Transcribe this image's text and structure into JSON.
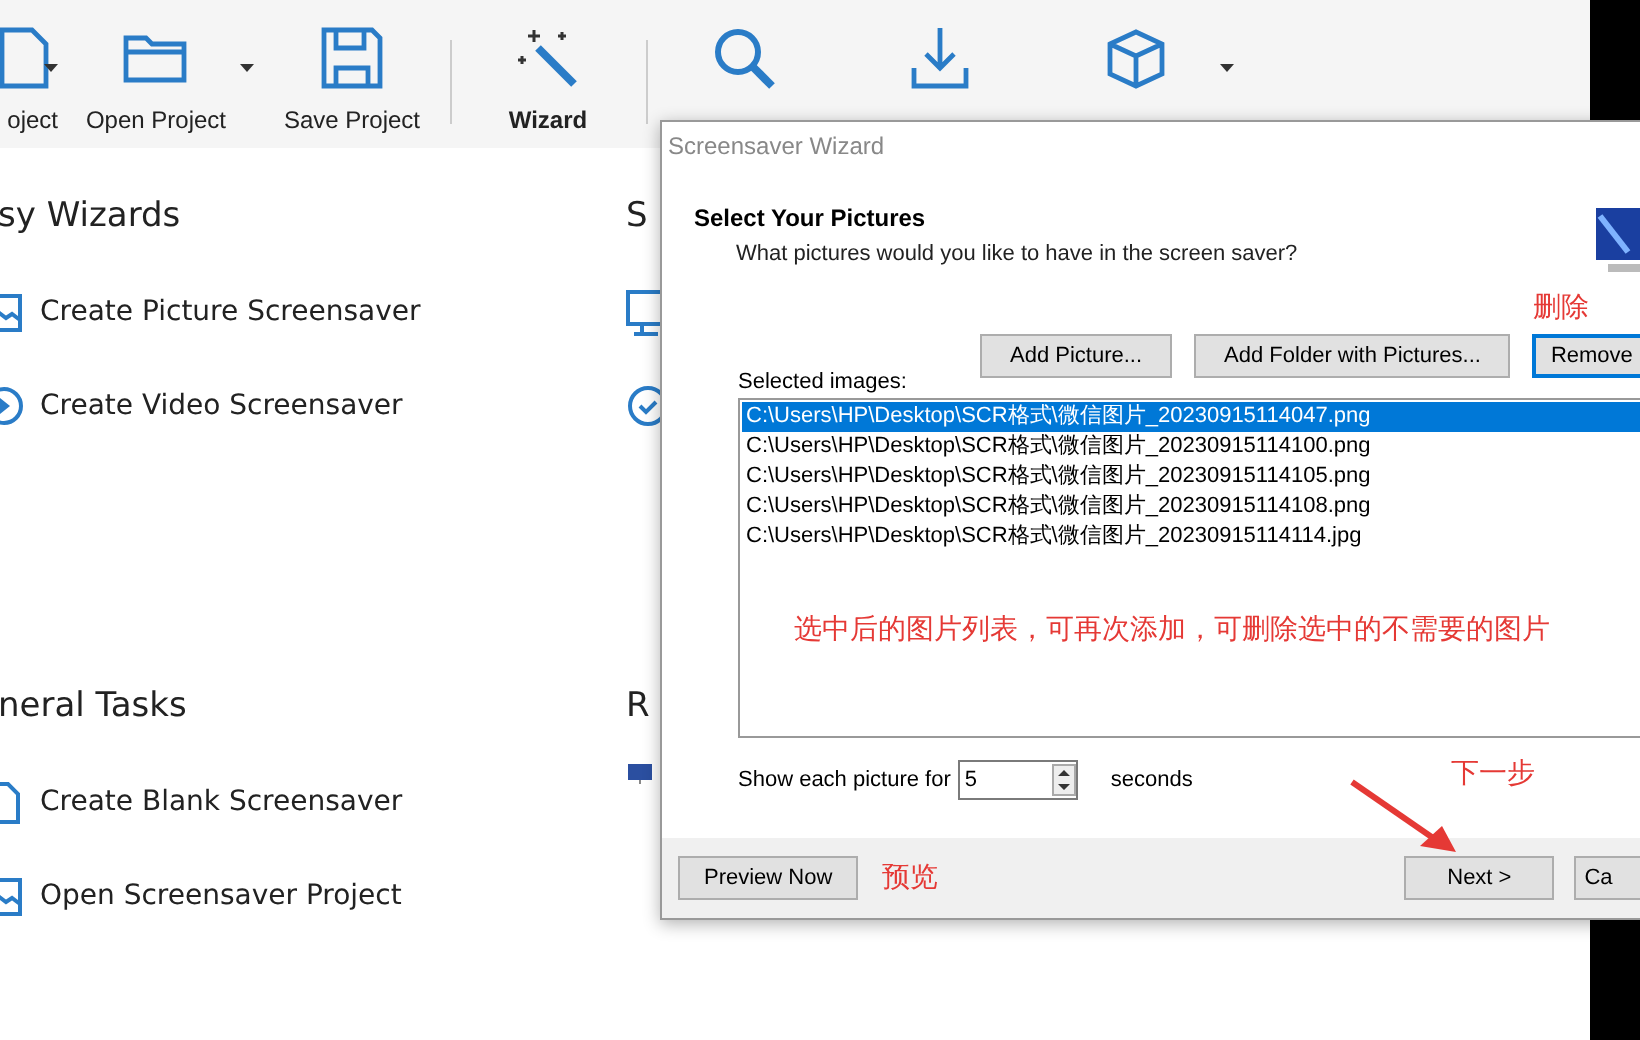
{
  "toolbar": {
    "items": [
      {
        "kind": "new",
        "label": "oject",
        "dropdown": true
      },
      {
        "kind": "open",
        "label": "Open Project",
        "dropdown": true
      },
      {
        "kind": "save",
        "label": "Save Project"
      },
      {
        "kind": "separator"
      },
      {
        "kind": "wizard",
        "label": "Wizard",
        "bold": true
      },
      {
        "kind": "separator"
      },
      {
        "kind": "preview"
      },
      {
        "kind": "build"
      },
      {
        "kind": "setup",
        "dropdown": true
      }
    ]
  },
  "sections": [
    {
      "title": "sy Wizards",
      "items": [
        {
          "kind": "picture",
          "label": "Create Picture Screensaver"
        },
        {
          "kind": "video",
          "label": "Create Video Screensaver"
        }
      ]
    },
    {
      "title": "neral Tasks",
      "items": [
        {
          "kind": "blank",
          "label": "Create Blank Screensaver"
        },
        {
          "kind": "open",
          "label": "Open Screensaver Project"
        }
      ]
    }
  ],
  "side_sections": [
    {
      "title": "S"
    },
    {
      "title": "R"
    }
  ],
  "dialog": {
    "title": "Screensaver Wizard",
    "heading": "Select Your Pictures",
    "subtitle": "What pictures would you like to have in the screen saver?",
    "buttons": [
      {
        "label": "Add Picture...",
        "focused": false
      },
      {
        "label": "Add Folder with Pictures...",
        "focused": false
      },
      {
        "label": "Remove",
        "focused": true
      }
    ],
    "list_label": "Selected images:",
    "files": [
      {
        "path": "C:\\Users\\HP\\Desktop\\SCR格式\\微信图片_20230915114047.png",
        "selected": true
      },
      {
        "path": "C:\\Users\\HP\\Desktop\\SCR格式\\微信图片_20230915114100.png",
        "selected": false
      },
      {
        "path": "C:\\Users\\HP\\Desktop\\SCR格式\\微信图片_20230915114105.png",
        "selected": false
      },
      {
        "path": "C:\\Users\\HP\\Desktop\\SCR格式\\微信图片_20230915114108.png",
        "selected": false
      },
      {
        "path": "C:\\Users\\HP\\Desktop\\SCR格式\\微信图片_20230915114114.jpg",
        "selected": false
      }
    ],
    "duration_label": "Show each picture for",
    "duration": "5",
    "duration_unit": "seconds",
    "preview_button": "Preview Now",
    "next_button": "Next >",
    "cancel_button": "Ca"
  },
  "annotations": {
    "remove": "删除",
    "list": "选中后的图片列表，可再次添加，可删除选中的不需要的图片",
    "preview": "预览",
    "next": "下一步"
  }
}
